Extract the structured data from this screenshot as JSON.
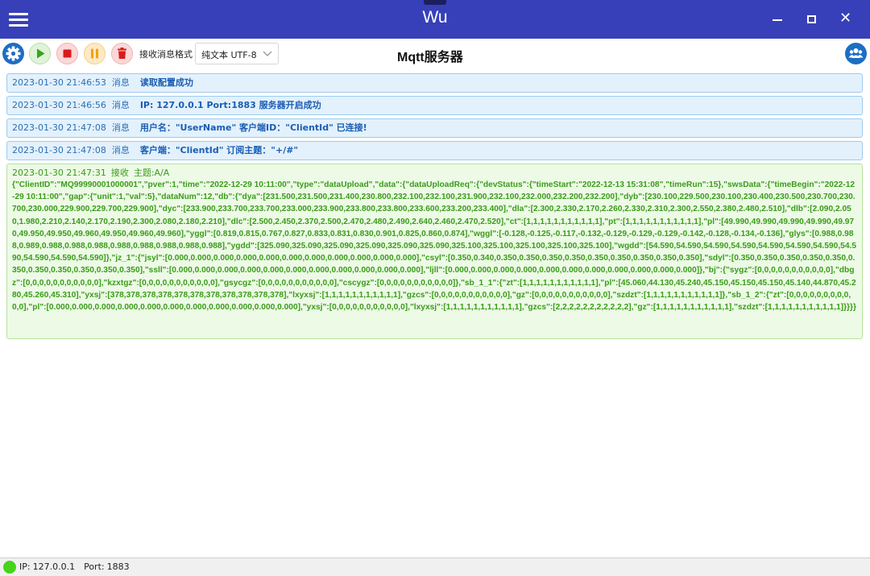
{
  "window": {
    "title": "Wu",
    "close_glyph": "✕"
  },
  "toolbar": {
    "format_label": "接收消息格式",
    "format_selected": "纯文本 UTF-8",
    "page_title": "Mqtt服务器",
    "icons": [
      "gear-icon",
      "play-icon",
      "stop-icon",
      "pause-icon",
      "trash-icon",
      "users-icon"
    ],
    "colors": {
      "accent": "#3740b8",
      "settings": "#1d6ec4",
      "play": "#3aa51a",
      "stop": "#d91b1b",
      "pause": "#f0a30a"
    }
  },
  "log": {
    "messages": [
      {
        "time": "2023-01-30 21:46:53",
        "type": "消息",
        "text": "读取配置成功"
      },
      {
        "time": "2023-01-30 21:46:56",
        "type": "消息",
        "text": "IP: 127.0.0.1  Port:1883  服务器开启成功"
      },
      {
        "time": "2023-01-30 21:47:08",
        "type": "消息",
        "text": "用户名：\"UserName\" 客户端ID：\"ClientId\" 已连接!"
      },
      {
        "time": "2023-01-30 21:47:08",
        "type": "消息",
        "text": "客户端：\"ClientId\" 订阅主题：\"+/#\""
      }
    ],
    "received": {
      "time": "2023-01-30 21:47:31",
      "type": "接收",
      "topic": "主题:A/A",
      "payload": "{\"ClientID\":\"MQ99990001000001\",\"pver\":1,\"time\":\"2022-12-29 10:11:00\",\"type\":\"dataUpload\",\"data\":{\"dataUploadReq\":{\"devStatus\":{\"timeStart\":\"2022-12-13 15:31:08\",\"timeRun\":15},\"swsData\":{\"timeBegin\":\"2022-12-29 10:11:00\",\"gap\":{\"unit\":1,\"val\":5},\"dataNum\":12,\"db\":{\"dya\":[231.500,231.500,231.400,230.800,232.100,232.100,231.900,232.100,232.000,232.200,232.200],\"dyb\":[230.100,229.500,230.100,230.400,230.500,230.700,230.700,230.000,229.900,229.700,229.900],\"dyc\":[233.900,233.700,233.700,233.000,233.900,233.800,233.800,233.600,233.200,233.400],\"dla\":[2.300,2.330,2.170,2.260,2.330,2.310,2.300,2.550,2.380,2.480,2.510],\"dlb\":[2.090,2.050,1.980,2.210,2.140,2.170,2.190,2.300,2.080,2.180,2.210],\"dlc\":[2.500,2.450,2.370,2.500,2.470,2.480,2.490,2.640,2.460,2.470,2.520],\"ct\":[1,1,1,1,1,1,1,1,1,1,1],\"pt\":[1,1,1,1,1,1,1,1,1,1,1],\"pl\":[49.990,49.990,49.990,49.990,49.970,49.950,49.950,49.960,49.950,49.960,49.960],\"yggl\":[0.819,0.815,0.767,0.827,0.833,0.831,0.830,0.901,0.825,0.860,0.874],\"wggl\":[-0.128,-0.125,-0.117,-0.132,-0.129,-0.129,-0.129,-0.142,-0.128,-0.134,-0.136],\"glys\":[0.988,0.988,0.989,0.988,0.988,0.988,0.988,0.988,0.988,0.988,0.988],\"ygdd\":[325.090,325.090,325.090,325.090,325.090,325.090,325.100,325.100,325.100,325.100,325.100],\"wgdd\":[54.590,54.590,54.590,54.590,54.590,54.590,54.590,54.590,54.590,54.590,54.590]},\"jz_1\":{\"jsyl\":[0.000,0.000,0.000,0.000,0.000,0.000,0.000,0.000,0.000,0.000,0.000],\"csyl\":[0.350,0.340,0.350,0.350,0.350,0.350,0.350,0.350,0.350,0.350,0.350],\"sdyl\":[0.350,0.350,0.350,0.350,0.350,0.350,0.350,0.350,0.350,0.350,0.350],\"ssll\":[0.000,0.000,0.000,0.000,0.000,0.000,0.000,0.000,0.000,0.000,0.000],\"ljll\":[0.000,0.000,0.000,0.000,0.000,0.000,0.000,0.000,0.000,0.000,0.000]},\"bj\":{\"sygz\":[0,0,0,0,0,0,0,0,0,0,0],\"dbgz\":[0,0,0,0,0,0,0,0,0,0,0],\"kzxtgz\":[0,0,0,0,0,0,0,0,0,0,0],\"gsycgz\":[0,0,0,0,0,0,0,0,0,0,0],\"cscygz\":[0,0,0,0,0,0,0,0,0,0,0]},\"sb_1_1\":{\"zt\":[1,1,1,1,1,1,1,1,1,1,1],\"pl\":[45.060,44.130,45.240,45.150,45.150,45.150,45.140,44.870,45.280,45.260,45.310],\"yxsj\":[378,378,378,378,378,378,378,378,378,378,378],\"lxyxsj\":[1,1,1,1,1,1,1,1,1,1,1],\"gzcs\":[0,0,0,0,0,0,0,0,0,0,0],\"gz\":[0,0,0,0,0,0,0,0,0,0,0],\"szdzt\":[1,1,1,1,1,1,1,1,1,1,1]},\"sb_1_2\":{\"zt\":[0,0,0,0,0,0,0,0,0,0,0],\"pl\":[0.000,0.000,0.000,0.000,0.000,0.000,0.000,0.000,0.000,0.000,0.000],\"yxsj\":[0,0,0,0,0,0,0,0,0,0,0],\"lxyxsj\":[1,1,1,1,1,1,1,1,1,1,1],\"gzcs\":[2,2,2,2,2,2,2,2,2,2,2],\"gz\":[1,1,1,1,1,1,1,1,1,1,1],\"szdzt\":[1,1,1,1,1,1,1,1,1,1,1]}}}}"
    }
  },
  "status": {
    "ip_label": "IP:",
    "ip_value": "127.0.0.1",
    "port_label": "Port:",
    "port_value": "1883",
    "connected_color": "#45d41a"
  }
}
